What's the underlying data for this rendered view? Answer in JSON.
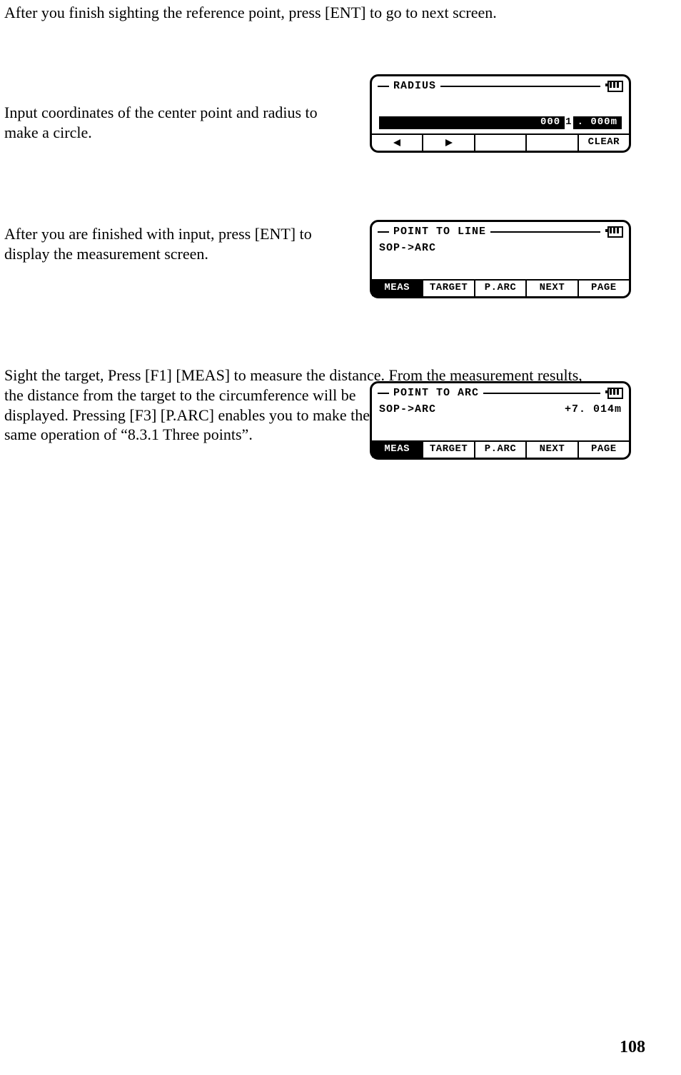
{
  "para1": "After you finish sighting the reference point, press [ENT] to go to next screen.",
  "para2": "Input coordinates of the center point and radius to make a circle.",
  "para3": "After you are finished with input, press [ENT] to display the measurement screen.",
  "para4a": "Sight the target, Press [F1] [MEAS] to measure the distance. From the measurement results,",
  "para4b": "the distance from the target to the circumference will be displayed.  Pressing [F3] [P.ARC] enables you to make the same operation of “8.3.1 Three points”.",
  "page_number": "108",
  "screen1": {
    "title": "RADIUS",
    "value_left": "000",
    "value_cursor": "1",
    "value_right": ". 000m",
    "softkeys": {
      "s1": "←",
      "s2": "→",
      "s5": "CLEAR"
    }
  },
  "screen2": {
    "title": "POINT TO LINE",
    "line1": "SOP->ARC",
    "softkeys": {
      "s1": "MEAS",
      "s2": "TARGET",
      "s3": "P.ARC",
      "s4": "NEXT",
      "s5": "PAGE"
    }
  },
  "screen3": {
    "title": "POINT TO ARC",
    "line1_left": "SOP->ARC",
    "line1_right": "+7. 014m",
    "softkeys": {
      "s1": "MEAS",
      "s2": "TARGET",
      "s3": "P.ARC",
      "s4": "NEXT",
      "s5": "PAGE"
    }
  }
}
